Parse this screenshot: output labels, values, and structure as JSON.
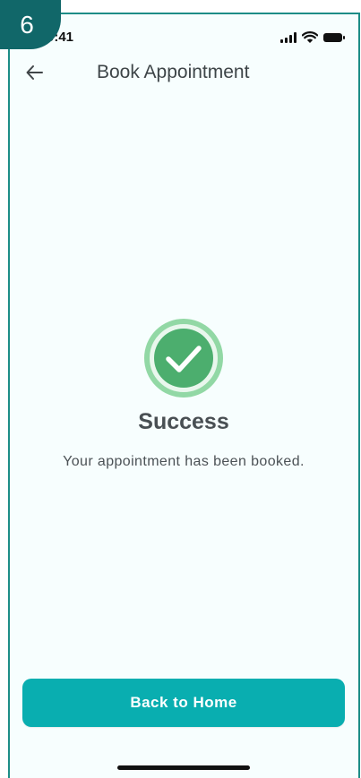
{
  "step_badge": "6",
  "status_bar": {
    "time": "9:41",
    "icons": [
      "signal-icon",
      "wifi-icon",
      "battery-icon"
    ]
  },
  "header": {
    "back_icon": "arrow-left-icon",
    "title": "Book Appointment"
  },
  "confirmation": {
    "icon": "check-circle-icon",
    "heading": "Success",
    "message": "Your appointment has been booked."
  },
  "actions": {
    "primary_label": "Back to Home"
  },
  "colors": {
    "accent": "#09aeb0",
    "success": "#4cae6e",
    "success_ring": "#92d8a5",
    "badge": "#116769",
    "text_primary": "#3e4548"
  }
}
